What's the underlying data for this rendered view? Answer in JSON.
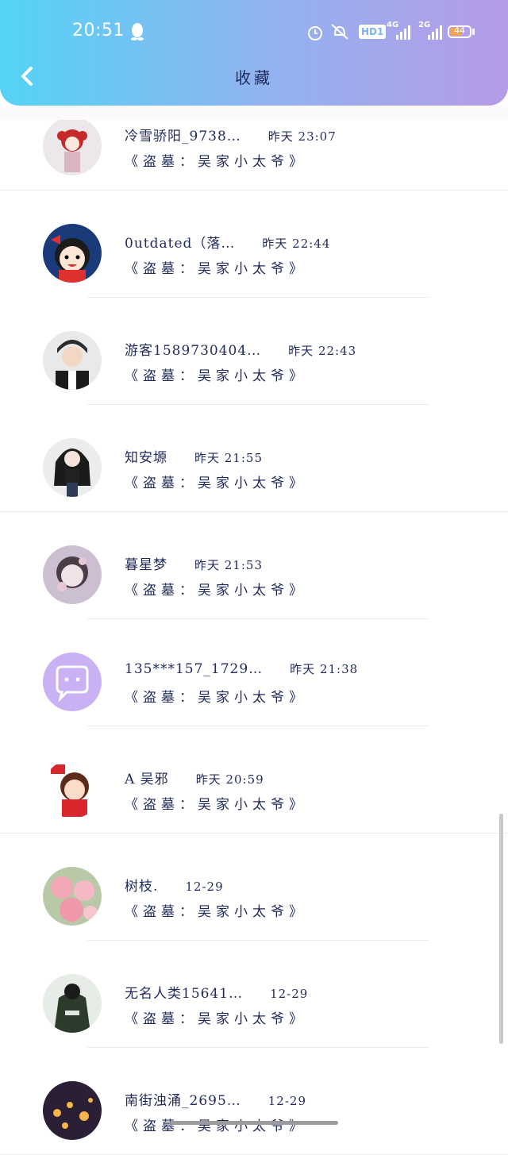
{
  "status_bar": {
    "time": "20:51",
    "hd_label": "HD1",
    "signal_1_label": "4G",
    "signal_2_label": "2G",
    "battery": "44"
  },
  "header": {
    "title": "收藏"
  },
  "colors": {
    "header_gradient_start": "#54d3f6",
    "header_gradient_end": "#b69be8",
    "text": "#1f2a5a"
  },
  "favorites": [
    {
      "name": "冷雪骄阳_9738…",
      "time": "昨天 23:07",
      "title": "《盗墓：吴家小太爷》",
      "avatar": "red-girl-avatar"
    },
    {
      "name": "0utdated（落…",
      "time": "昨天 22:44",
      "title": "《盗墓：吴家小太爷》",
      "avatar": "cartoon-girl-avatar"
    },
    {
      "name": "游客1589730404…",
      "time": "昨天 22:43",
      "title": "《盗墓：吴家小太爷》",
      "avatar": "boy-avatar"
    },
    {
      "name": "知安塬",
      "time": "昨天 21:55",
      "title": "《盗墓：吴家小太爷》",
      "avatar": "girl-bw-avatar"
    },
    {
      "name": "暮星梦",
      "time": "昨天 21:53",
      "title": "《盗墓：吴家小太爷》",
      "avatar": "girl-flower-avatar"
    },
    {
      "name": "135***157_1729…",
      "time": "昨天 21:38",
      "title": "《盗墓：吴家小太爷》",
      "avatar": "chat-bubble-avatar"
    },
    {
      "name": "A 吴邪",
      "time": "昨天 20:59",
      "title": "《盗墓：吴家小太爷》",
      "avatar": "flag-girl-avatar"
    },
    {
      "name": "树枝.",
      "time": "12-29",
      "title": "《盗墓：吴家小太爷》",
      "avatar": "roses-avatar"
    },
    {
      "name": "无名人类15641…",
      "time": "12-29",
      "title": "《盗墓：吴家小太爷》",
      "avatar": "jacket-avatar"
    },
    {
      "name": "南街浊涌_2695…",
      "time": "12-29",
      "title": "《盗墓：吴家小太爷》",
      "avatar": "lanterns-avatar"
    }
  ]
}
